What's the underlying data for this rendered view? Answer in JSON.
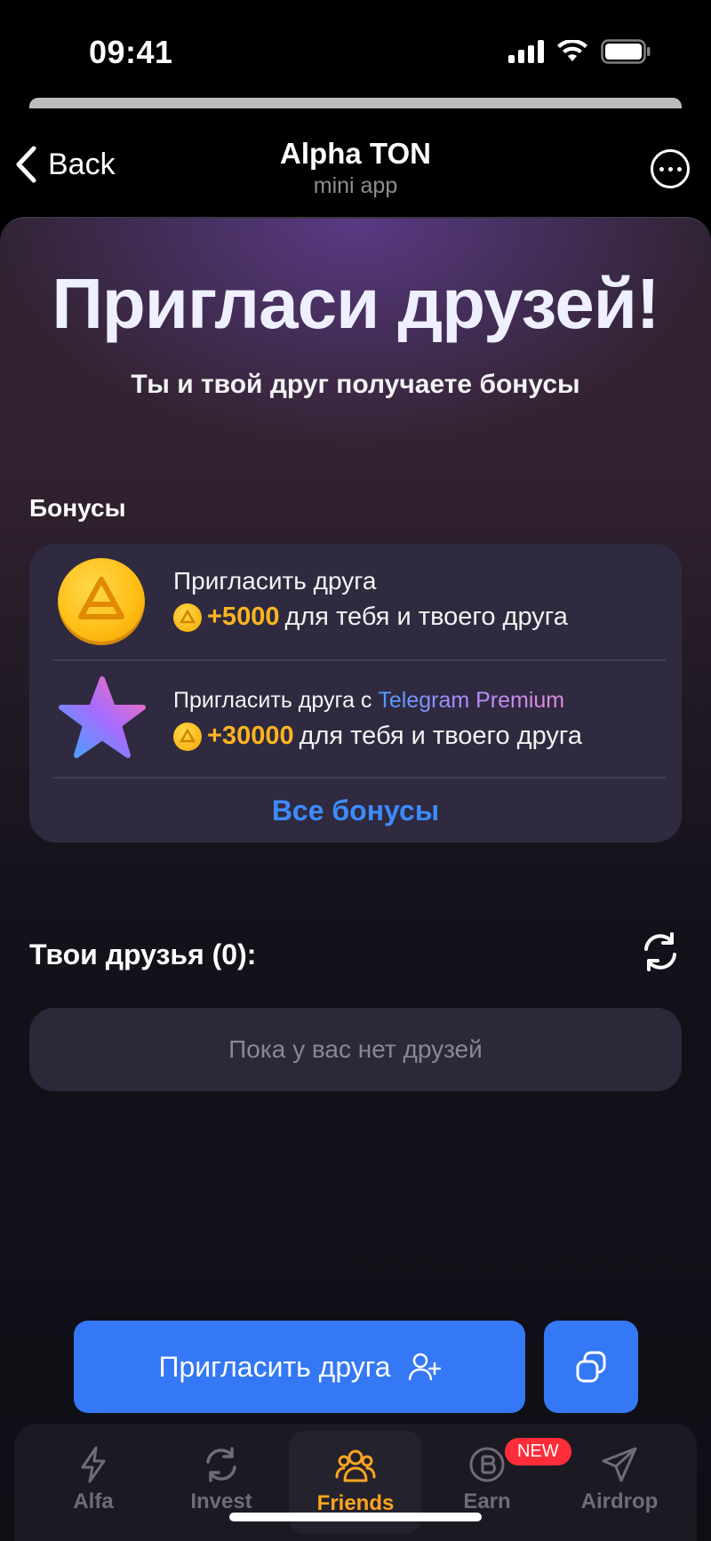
{
  "status": {
    "time": "09:41"
  },
  "nav": {
    "back_label": "Back",
    "title": "Alpha TON",
    "subtitle": "mini app"
  },
  "hero": {
    "title": "Пригласи друзей!",
    "subtitle": "Ты и твой друг получаете бонусы"
  },
  "bonuses": {
    "section_label": "Бонусы",
    "items": [
      {
        "title": "Пригласить друга",
        "amount": "+5000",
        "reward_text": "для тебя и твоего друга",
        "icon": "coin-icon"
      },
      {
        "title_prefix": "Пригласить друга с ",
        "title_highlight": "Telegram Premium",
        "amount": "+30000",
        "reward_text": "для тебя и твоего друга",
        "icon": "premium-star-icon"
      }
    ],
    "all_label": "Все бонусы"
  },
  "friends": {
    "label": "Твои друзья (0):",
    "empty_text": "Пока у вас нет друзей"
  },
  "actions": {
    "invite_label": "Пригласить друга"
  },
  "tabs": [
    {
      "label": "Alfa",
      "icon": "lightning-icon"
    },
    {
      "label": "Invest",
      "icon": "refresh-icon"
    },
    {
      "label": "Friends",
      "icon": "friends-icon",
      "active": true
    },
    {
      "label": "Earn",
      "icon": "bitcoin-icon",
      "badge": "NEW"
    },
    {
      "label": "Airdrop",
      "icon": "paper-plane-icon"
    }
  ],
  "colors": {
    "accent_blue": "#3478f6",
    "gold": "#ffb420",
    "badge_red": "#ff2d3a"
  }
}
